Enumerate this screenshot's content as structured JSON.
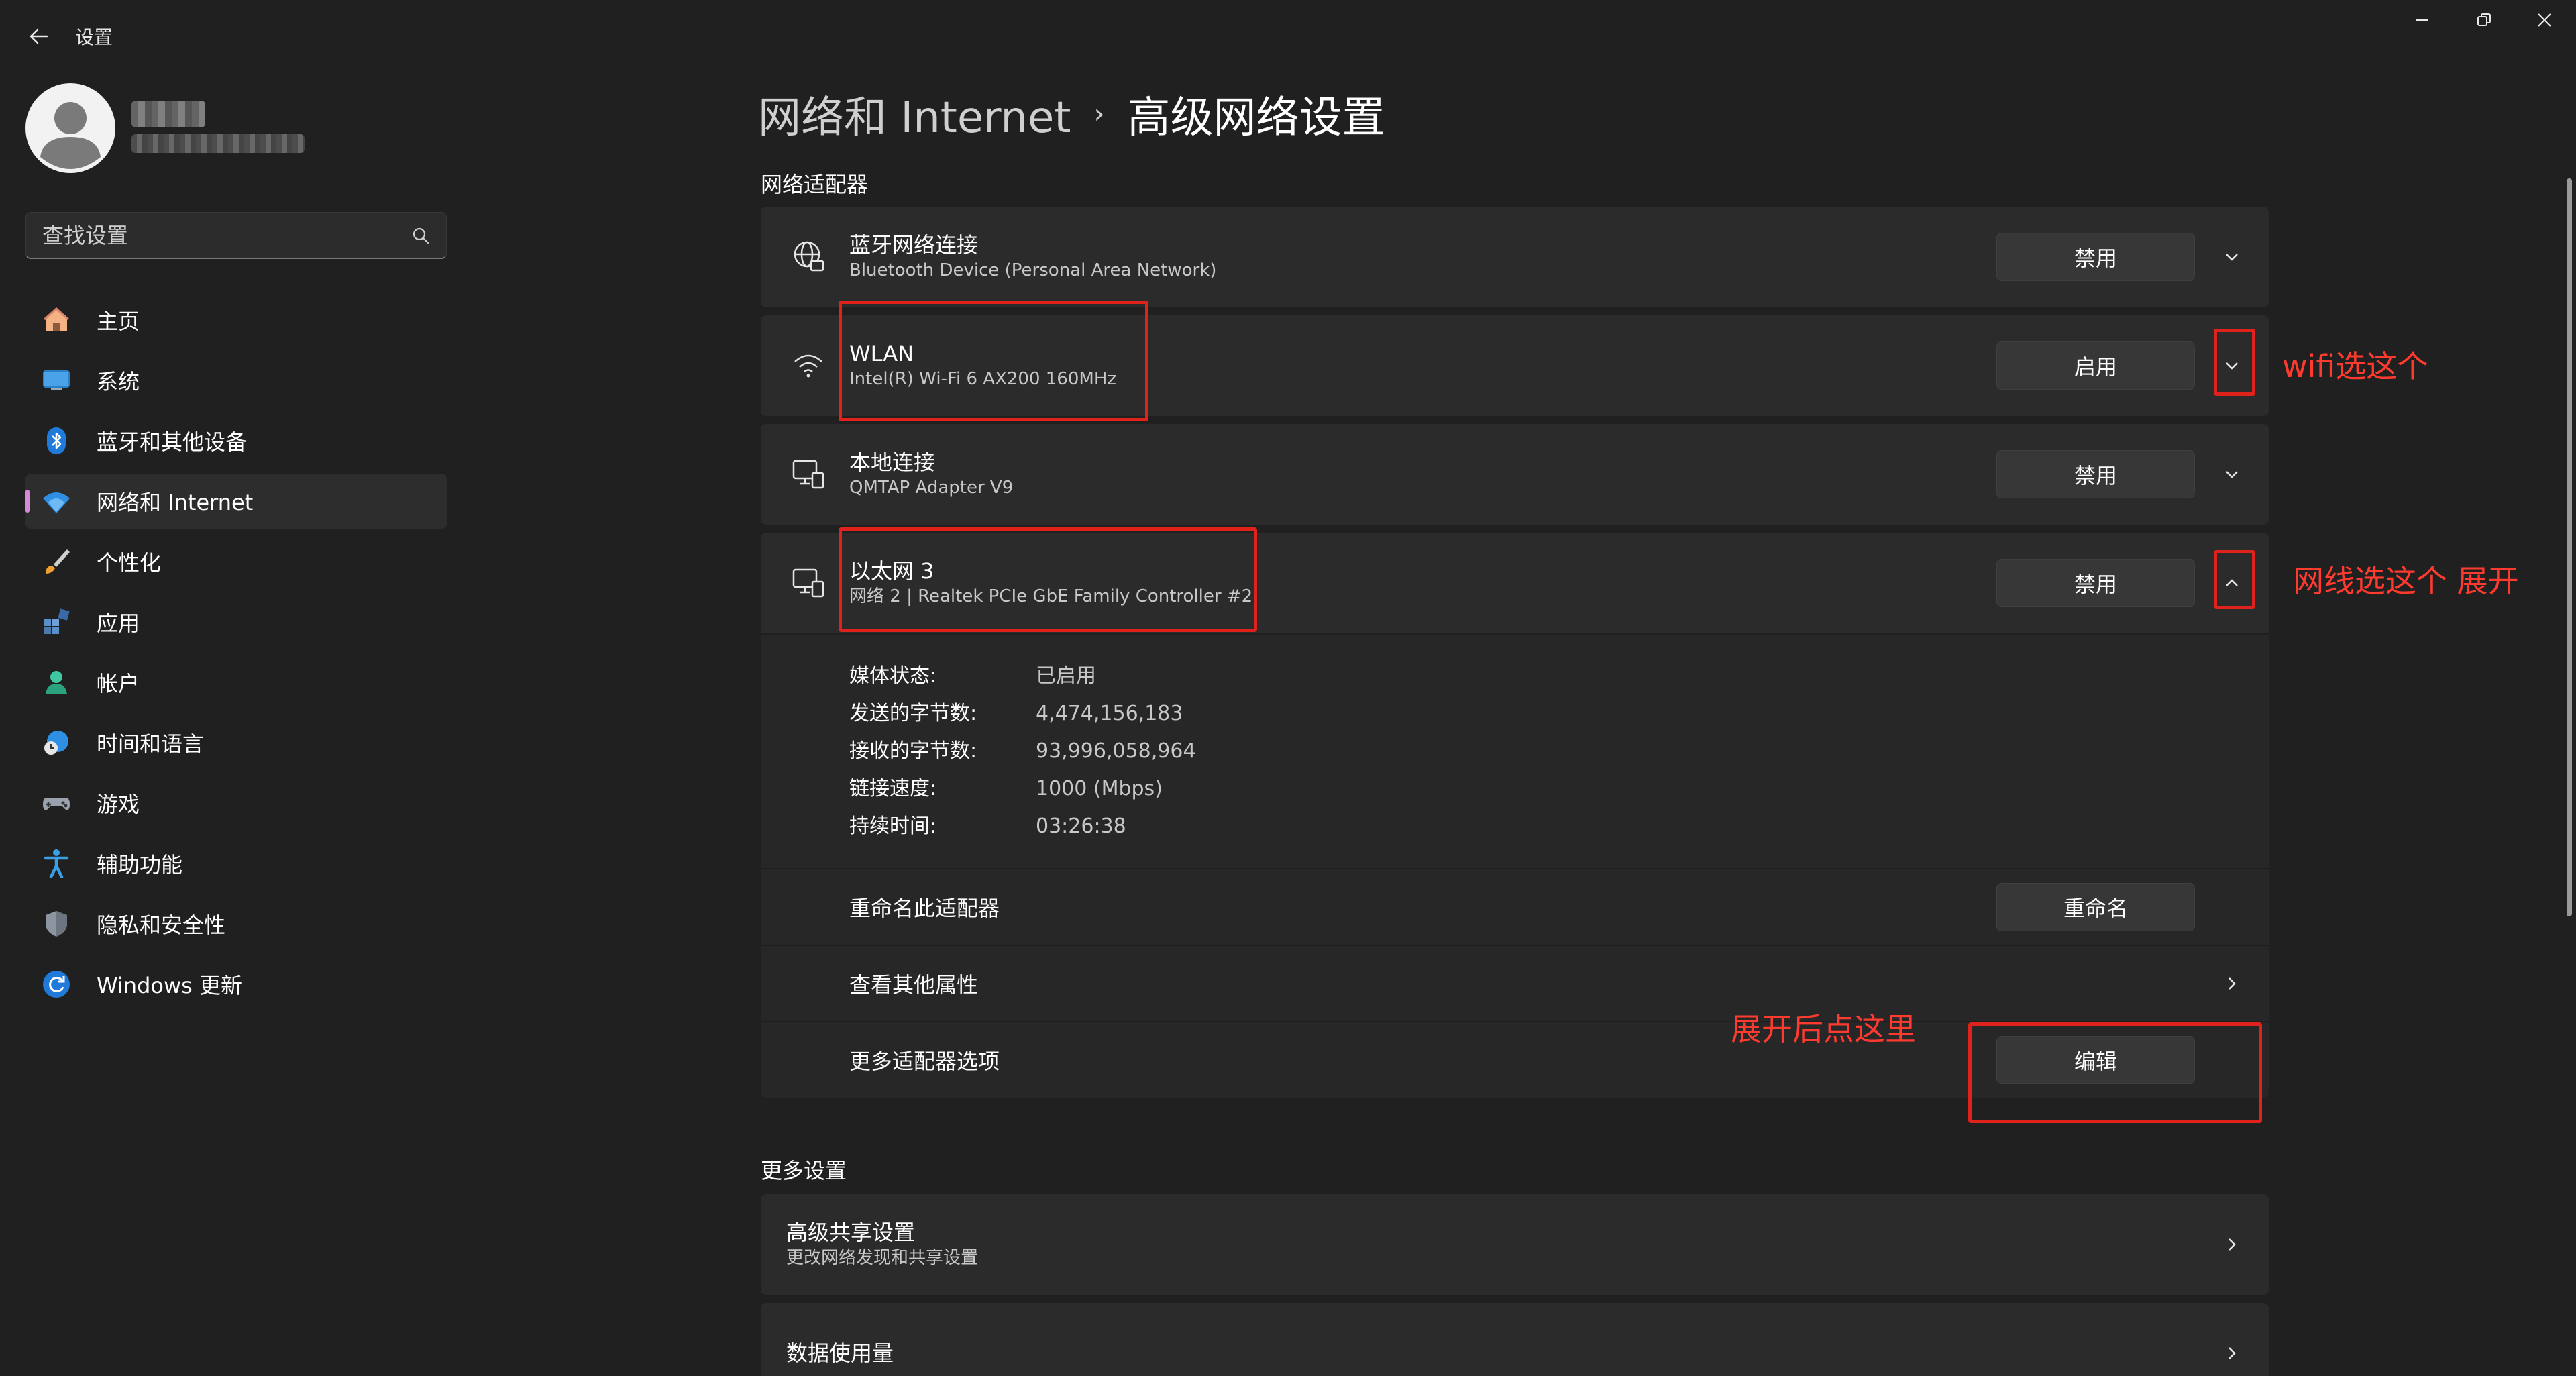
{
  "app": {
    "title": "设置"
  },
  "sidebar": {
    "search_placeholder": "查找设置",
    "items": [
      {
        "label": "主页",
        "icon": "home-icon"
      },
      {
        "label": "系统",
        "icon": "system-display-icon"
      },
      {
        "label": "蓝牙和其他设备",
        "icon": "bluetooth-icon"
      },
      {
        "label": "网络和 Internet",
        "icon": "wifi-icon",
        "active": true
      },
      {
        "label": "个性化",
        "icon": "paintbrush-icon"
      },
      {
        "label": "应用",
        "icon": "apps-icon"
      },
      {
        "label": "帐户",
        "icon": "person-icon"
      },
      {
        "label": "时间和语言",
        "icon": "clock-globe-icon"
      },
      {
        "label": "游戏",
        "icon": "gamepad-icon"
      },
      {
        "label": "辅助功能",
        "icon": "accessibility-icon"
      },
      {
        "label": "隐私和安全性",
        "icon": "shield-icon"
      },
      {
        "label": "Windows 更新",
        "icon": "refresh-icon"
      }
    ]
  },
  "header": {
    "breadcrumb_parent": "网络和 Internet",
    "breadcrumb_separator": "›",
    "breadcrumb_current": "高级网络设置"
  },
  "adapters": {
    "section_title": "网络适配器",
    "items": [
      {
        "title": "蓝牙网络连接",
        "subtitle": "Bluetooth Device (Personal Area Network)",
        "button": "禁用",
        "icon": "globe-network-icon",
        "expanded": false
      },
      {
        "title": "WLAN",
        "subtitle": "Intel(R) Wi-Fi 6 AX200 160MHz",
        "button": "启用",
        "icon": "wifi-icon",
        "expanded": false
      },
      {
        "title": "本地连接",
        "subtitle": "QMTAP Adapter V9",
        "button": "禁用",
        "icon": "ethernet-monitor-icon",
        "expanded": false
      },
      {
        "title": "以太网 3",
        "subtitle": "网络 2 | Realtek PCIe GbE Family Controller #2",
        "button": "禁用",
        "icon": "ethernet-monitor-icon",
        "expanded": true
      }
    ],
    "details": [
      {
        "key": "媒体状态:",
        "value": "已启用"
      },
      {
        "key": "发送的字节数:",
        "value": "4,474,156,183"
      },
      {
        "key": "接收的字节数:",
        "value": "93,996,058,964"
      },
      {
        "key": "链接速度:",
        "value": "1000 (Mbps)"
      },
      {
        "key": "持续时间:",
        "value": "03:26:38"
      }
    ],
    "rename_label": "重命名此适配器",
    "rename_button": "重命名",
    "properties_label": "查看其他属性",
    "more_options_label": "更多适配器选项",
    "edit_button": "编辑"
  },
  "more_settings": {
    "section_title": "更多设置",
    "items": [
      {
        "title": "高级共享设置",
        "subtitle": "更改网络发现和共享设置"
      },
      {
        "title": "数据使用量",
        "subtitle": ""
      }
    ]
  },
  "annotations": {
    "wifi": "wifi选这个",
    "ethernet": "网线选这个 展开",
    "edit": "展开后点这里"
  },
  "colors": {
    "background": "#202020",
    "card": "#2b2b2b",
    "accent": "#d589d8",
    "annotation": "#e0221c"
  }
}
